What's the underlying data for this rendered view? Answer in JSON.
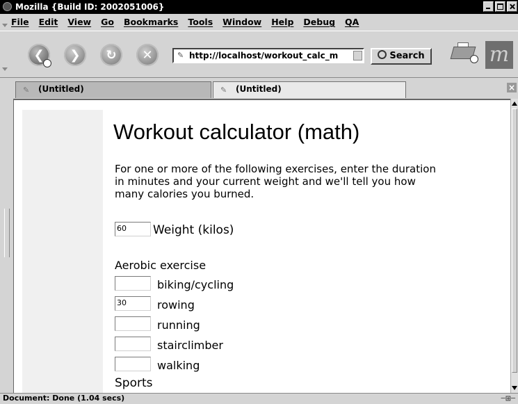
{
  "window": {
    "title": "Mozilla {Build ID: 2002051006}"
  },
  "menu": [
    "File",
    "Edit",
    "View",
    "Go",
    "Bookmarks",
    "Tools",
    "Window",
    "Help",
    "Debug",
    "QA"
  ],
  "nav": {
    "url": "http://localhost/workout_calc_m",
    "search_label": "Search"
  },
  "tabs": [
    {
      "label": "(Untitled)"
    },
    {
      "label": "(Untitled)"
    }
  ],
  "page": {
    "heading": "Workout calculator (math)",
    "intro": "For one or more of the following exercises, enter the duration in minutes and your current weight and we'll tell you how many calories you burned.",
    "weight": {
      "value": "60",
      "label": "Weight (kilos)"
    },
    "aerobic_heading": "Aerobic exercise",
    "aerobic_fields": [
      {
        "label": "biking/cycling",
        "value": ""
      },
      {
        "label": "rowing",
        "value": "30"
      },
      {
        "label": "running",
        "value": ""
      },
      {
        "label": "stairclimber",
        "value": ""
      },
      {
        "label": "walking",
        "value": ""
      }
    ],
    "sports_heading": "Sports"
  },
  "status": {
    "text": "Document: Done (1.04 secs)"
  }
}
